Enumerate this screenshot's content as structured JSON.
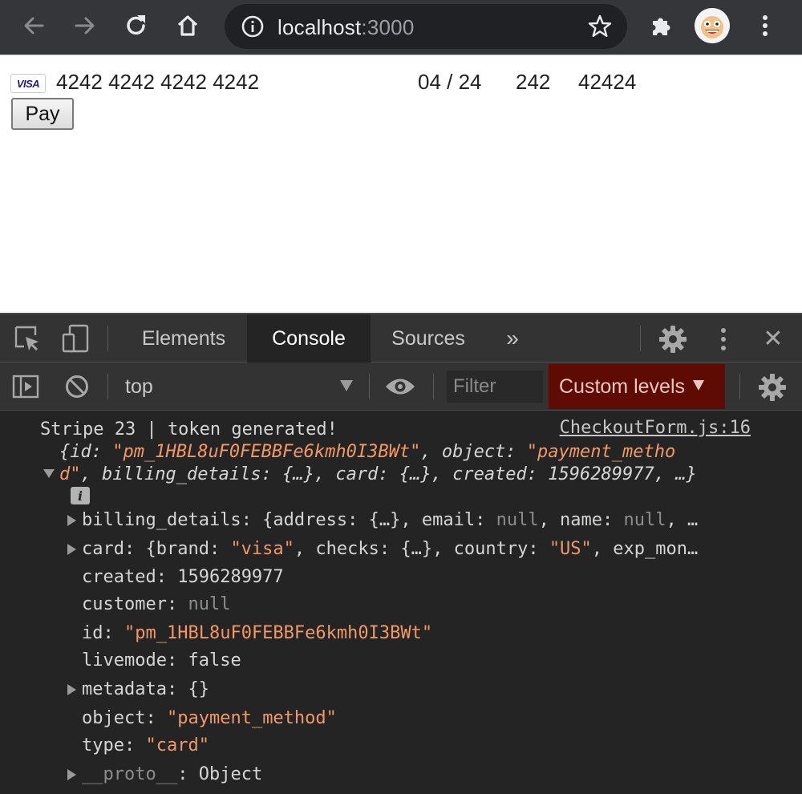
{
  "browser": {
    "url_host": "localhost",
    "url_port": ":3000",
    "icons": [
      "back-arrow-icon",
      "forward-arrow-icon",
      "reload-icon",
      "home-icon",
      "info-icon",
      "star-icon",
      "puzzle-extension-icon",
      "profile-avatar",
      "kebab-menu-icon"
    ]
  },
  "page": {
    "card_brand": "VISA",
    "card_number": "4242 4242 4242 4242",
    "expiry": "04 / 24",
    "cvc": "242",
    "zip": "42424",
    "pay_label": "Pay"
  },
  "devtools": {
    "tabs": [
      "Elements",
      "Console",
      "Sources"
    ],
    "more_tabs": "»",
    "active_tab": "Console",
    "context": "top",
    "filter_placeholder": "Filter",
    "levels_label": "Custom levels",
    "levels_color": "#5e0c03",
    "close_label": "✕"
  },
  "console": {
    "message": "Stripe 23 | token generated!",
    "source": "CheckoutForm.js:16",
    "summary_line1": {
      "open": "{id: ",
      "id_value": "\"pm_1HBL8uF0FEBBFe6kmh0I3BWt\"",
      "sep": ", object: ",
      "object_value_part1": "\"payment_metho"
    },
    "summary_line2": {
      "object_value_part2": "d\"",
      "rest": ", billing_details: {…}, card: {…}, created: 1596289977, …}"
    },
    "info_badge": "i",
    "properties": {
      "billing_details": {
        "key": "billing_details",
        "pre": ": {address: {…}, email: ",
        "null1": "null",
        "mid": ", name: ",
        "null2": "null",
        "post": ", …"
      },
      "card": {
        "key": "card",
        "pre": ": {brand: ",
        "brand": "\"visa\"",
        "mid": ", checks: {…}, country: ",
        "country": "\"US\"",
        "post": ", exp_mon…"
      },
      "created": {
        "key": "created",
        "value": "1596289977"
      },
      "customer": {
        "key": "customer",
        "value": "null"
      },
      "id": {
        "key": "id",
        "value": "\"pm_1HBL8uF0FEBBFe6kmh0I3BWt\""
      },
      "livemode": {
        "key": "livemode",
        "value": "false"
      },
      "metadata": {
        "key": "metadata",
        "value": "{}"
      },
      "object": {
        "key": "object",
        "value": "\"payment_method\""
      },
      "type": {
        "key": "type",
        "value": "\"card\""
      },
      "proto": {
        "key": "__proto__",
        "value": "Object"
      }
    },
    "colors": {
      "string": "#f29766",
      "null": "#8c8c8c",
      "text": "#d5d5d5"
    }
  }
}
